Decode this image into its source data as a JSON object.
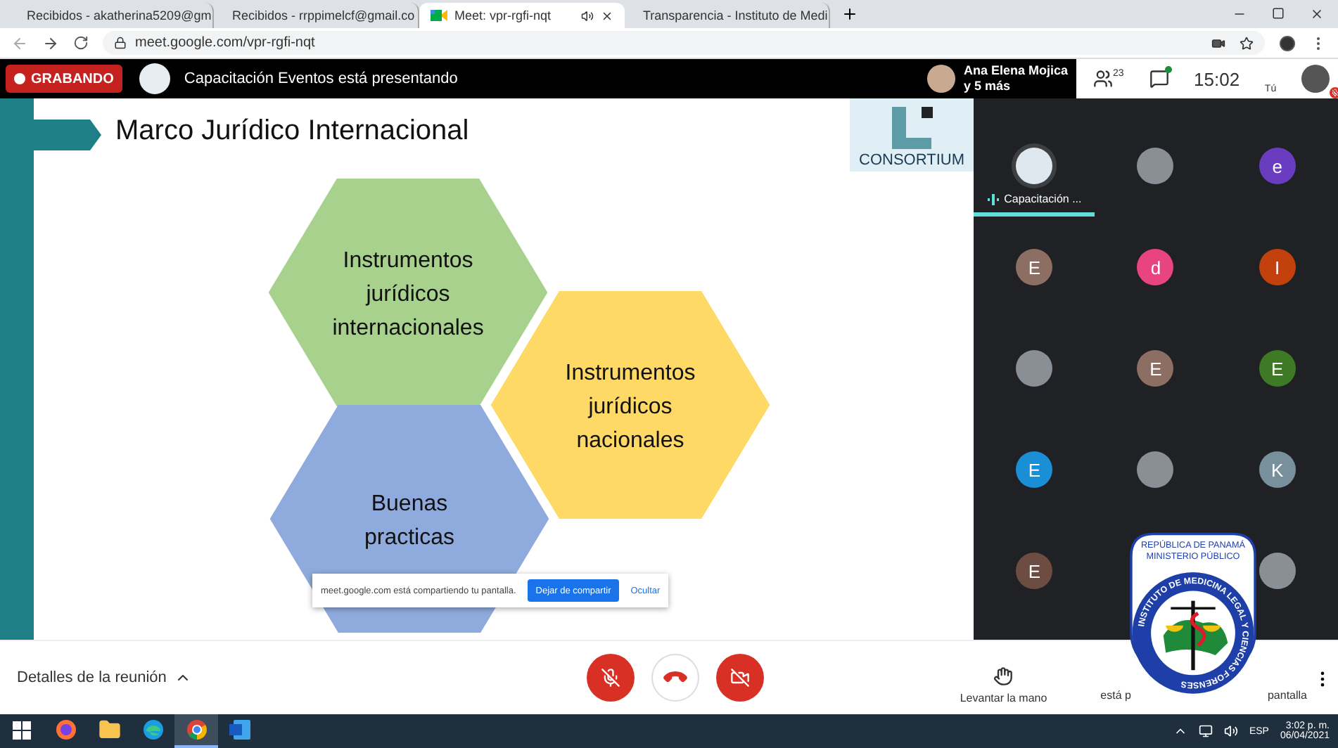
{
  "browser": {
    "tabs": [
      {
        "kind": "mail",
        "title": "Recibidos - akatherina5209@gm",
        "selected": false,
        "audio": false
      },
      {
        "kind": "mail",
        "title": "Recibidos - rrppimelcf@gmail.co",
        "selected": false,
        "audio": false
      },
      {
        "kind": "meet",
        "title": "Meet: vpr-rgfi-nqt",
        "selected": true,
        "audio": true
      },
      {
        "kind": "flag",
        "title": "Transparencia - Instituto de Medi",
        "selected": false,
        "audio": false
      }
    ],
    "url": "meet.google.com/vpr-rgfi-nqt"
  },
  "meet_bar": {
    "recording_label": "GRABANDO",
    "presenter_text": "Capacitación Eventos está presentando",
    "pinned_name": "Ana Elena Mojica",
    "pinned_more": "y 5 más",
    "people_count": "23",
    "chat_unread": true,
    "time": "15:02",
    "self_label": "Tú",
    "self_muted": true
  },
  "slide": {
    "title": "Marco Jurídico Internacional",
    "logo_text": "CONSORTIUM",
    "hexagons": [
      {
        "lines": [
          "Instrumentos",
          "jurídicos",
          "internacionales"
        ],
        "color": "#a9d18e"
      },
      {
        "lines": [
          "Instrumentos",
          "jurídicos",
          "nacionales"
        ],
        "color": "#ffd966"
      },
      {
        "lines": [
          "Buenas",
          "practicas"
        ],
        "color": "#8faadc"
      }
    ],
    "share_bar": {
      "message": "meet.google.com está compartiendo tu pantalla.",
      "stop_button": "Dejar de compartir",
      "hide_link": "Ocultar"
    }
  },
  "participants": [
    {
      "kind": "logo",
      "name": "Capacitación ...",
      "speaking": true
    },
    {
      "kind": "photo",
      "speaking": false
    },
    {
      "kind": "letter",
      "letter": "e",
      "color": "#6a3cc0",
      "speaking": false
    },
    {
      "kind": "letter",
      "letter": "E",
      "color": "#8d6e63",
      "speaking": false
    },
    {
      "kind": "letter",
      "letter": "d",
      "color": "#e8447f",
      "speaking": false
    },
    {
      "kind": "letter",
      "letter": "I",
      "color": "#c2410c",
      "speaking": false
    },
    {
      "kind": "photo",
      "speaking": false
    },
    {
      "kind": "letter",
      "letter": "E",
      "color": "#8d6e63",
      "speaking": false
    },
    {
      "kind": "letter",
      "letter": "E",
      "color": "#3e7a26",
      "speaking": false
    },
    {
      "kind": "letter",
      "letter": "E",
      "color": "#1a8fd6",
      "speaking": false
    },
    {
      "kind": "photo",
      "speaking": false
    },
    {
      "kind": "letter",
      "letter": "K",
      "color": "#78909c",
      "speaking": false
    },
    {
      "kind": "letter",
      "letter": "E",
      "color": "#6d4c41",
      "speaking": false
    },
    {
      "kind": "hidden",
      "speaking": false
    },
    {
      "kind": "photo",
      "speaking": false
    }
  ],
  "emblem": {
    "top_lines": [
      "REPÚBLICA DE PANAMÁ",
      "MINISTERIO PÚBLICO"
    ],
    "ring_text": "INSTITUTO DE MEDICINA LEGAL Y CIENCIAS FORENSES"
  },
  "controls": {
    "details_label": "Detalles de la reunión",
    "mic_muted": true,
    "camera_off": true,
    "raise_hand_label": "Levantar la mano",
    "present_label_parts": [
      "está p",
      "pantalla"
    ]
  },
  "taskbar": {
    "apps": [
      {
        "kind": "firefox",
        "active": false
      },
      {
        "kind": "folder",
        "active": false
      },
      {
        "kind": "edge",
        "active": false
      },
      {
        "kind": "chrome",
        "active": true
      },
      {
        "kind": "word",
        "active": false
      }
    ],
    "language": "ESP",
    "time": "3:02 p. m.",
    "date": "06/04/2021"
  }
}
